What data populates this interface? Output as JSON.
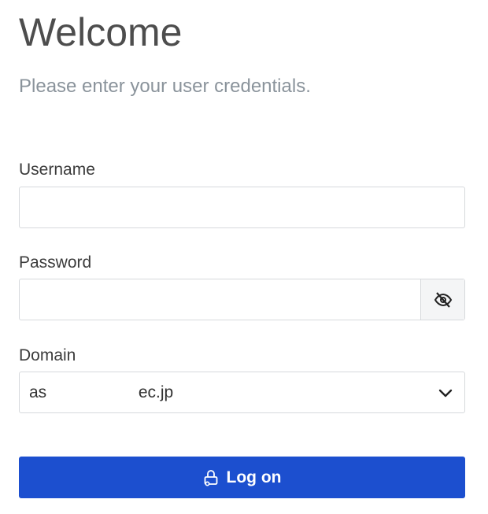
{
  "header": {
    "title": "Welcome",
    "subtitle": "Please enter your user credentials."
  },
  "form": {
    "username": {
      "label": "Username",
      "value": "",
      "placeholder": ""
    },
    "password": {
      "label": "Password",
      "value": "",
      "placeholder": "",
      "toggle_icon": "eye-slash-icon"
    },
    "domain": {
      "label": "Domain",
      "value": "as                    ec.jp",
      "icon": "chevron-down-icon"
    }
  },
  "logon_button": {
    "label": "Log on",
    "icon": "lock-icon",
    "color": "#1c4fcf"
  }
}
